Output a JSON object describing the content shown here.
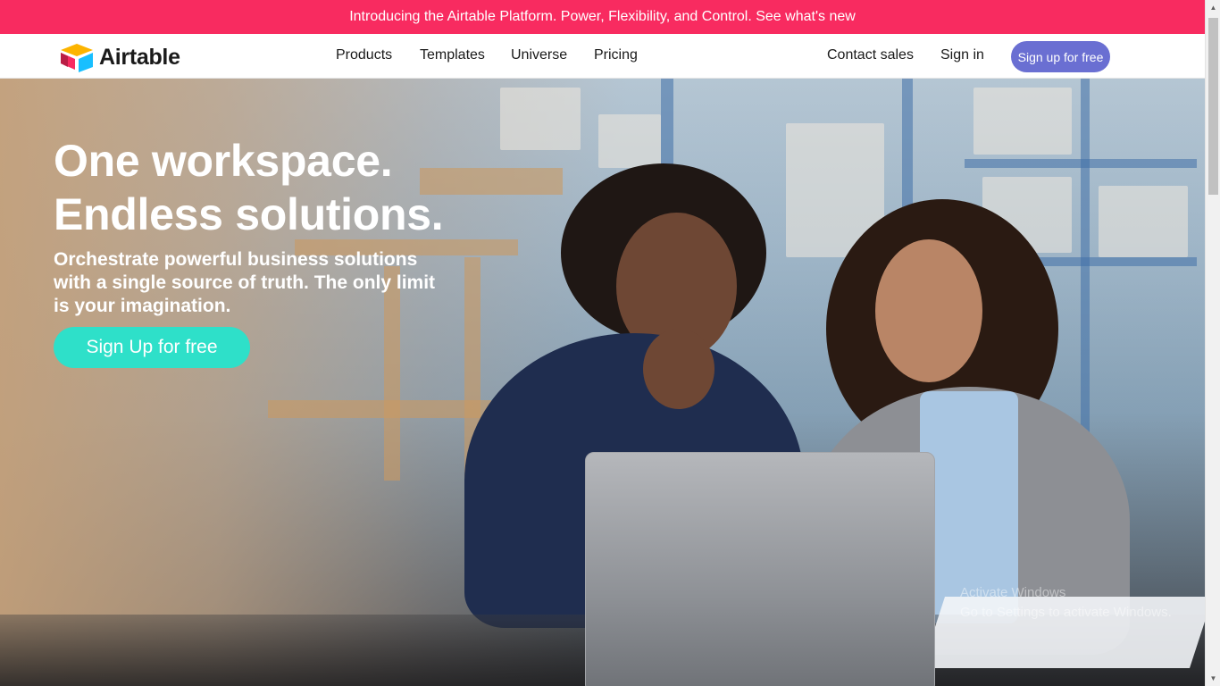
{
  "announcement": {
    "text": "Introducing the Airtable Platform. Power, Flexibility, and Control. See what's new"
  },
  "nav": {
    "brand": "Airtable",
    "links": [
      "Products",
      "Templates",
      "Universe",
      "Pricing"
    ],
    "contact": "Contact sales",
    "signin": "Sign in",
    "signup": "Sign up for free"
  },
  "hero": {
    "headline_line1": "One workspace.",
    "headline_line2": "Endless solutions.",
    "subhead": "Orchestrate powerful business solutions with a single source of truth. The only limit is your imagination.",
    "cta": "Sign Up for free"
  },
  "watermark": {
    "line1": "Activate Windows",
    "line2": "Go to Settings to activate Windows."
  },
  "colors": {
    "announcement_bg": "#f82b60",
    "signup_bg": "#6a6fd2",
    "cta_bg": "#2ee0c9"
  },
  "icons": {
    "logo": "airtable-logo-icon",
    "scroll_up": "scroll-up-icon",
    "scroll_down": "scroll-down-icon"
  }
}
